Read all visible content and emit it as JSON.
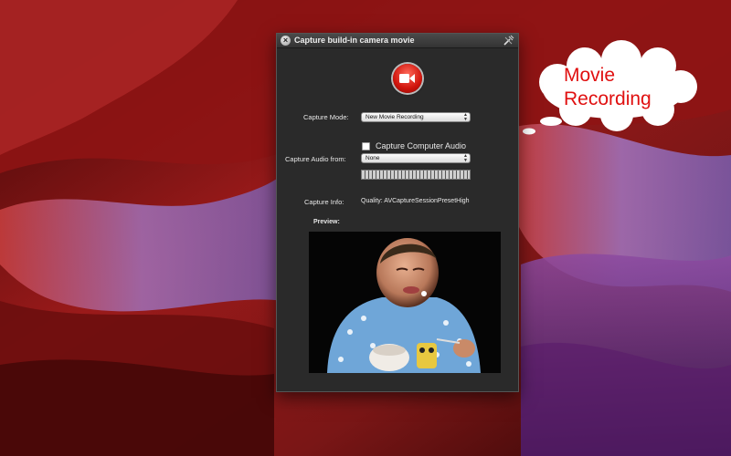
{
  "window": {
    "title": "Capture build-in camera movie"
  },
  "capture_mode": {
    "label": "Capture Mode:",
    "value": "New Movie Recording"
  },
  "capture_computer_audio": {
    "label": "Capture Computer Audio",
    "checked": false
  },
  "capture_audio_from": {
    "label": "Capture Audio from:",
    "value": "None"
  },
  "capture_info": {
    "label": "Capture Info:",
    "value": "Quality: AVCaptureSessionPresetHigh"
  },
  "preview": {
    "label": "Preview:"
  },
  "callout": {
    "line1": "Movie",
    "line2": "Recording",
    "color": "#e01010"
  },
  "icons": [
    "close-icon",
    "tools-icon",
    "video-camera-icon"
  ]
}
